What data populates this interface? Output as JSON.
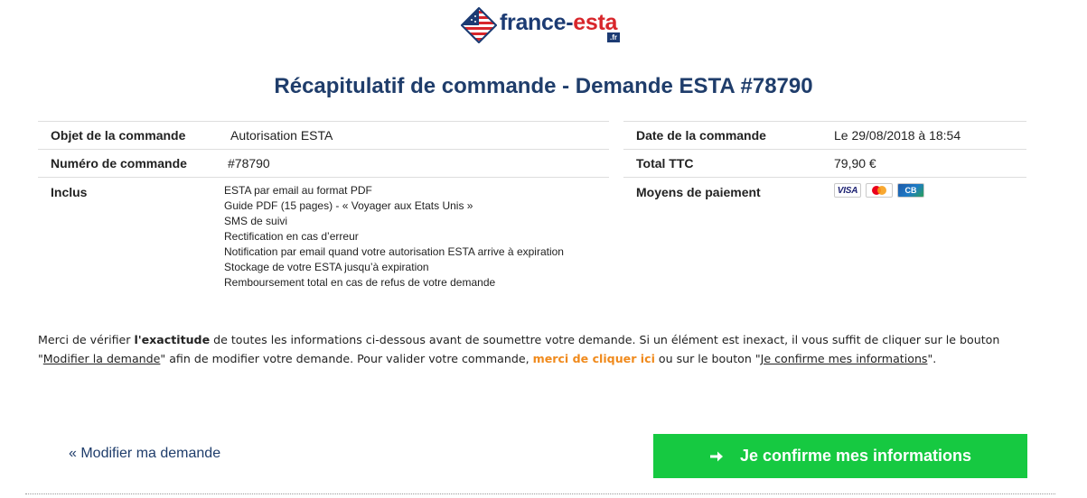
{
  "logo": {
    "part1": "france-",
    "part2": "esta",
    "tld": ".fr"
  },
  "title": "Récapitulatif de commande - Demande ESTA #78790",
  "order": {
    "object_label": "Objet de la commande",
    "object_value": "Autorisation ESTA",
    "number_label": "Numéro de commande",
    "number_value": "#78790",
    "includes_label": "Inclus",
    "includes": [
      "ESTA par email au format PDF",
      "Guide PDF (15 pages) - « Voyager aux Etats Unis »",
      "SMS de suivi",
      "Rectification en cas d’erreur",
      "Notification par email quand votre autorisation ESTA arrive à expiration",
      "Stockage de votre ESTA jusqu’à expiration",
      "Remboursement total en cas de refus de votre demande"
    ]
  },
  "summary": {
    "date_label": "Date de la commande",
    "date_value": "Le 29/08/2018 à 18:54",
    "total_label": "Total TTC",
    "total_value": "79,90 €",
    "payment_label": "Moyens de paiement",
    "payment_methods": [
      {
        "name": "visa-icon",
        "text": "VISA"
      },
      {
        "name": "mastercard-icon",
        "text": ""
      },
      {
        "name": "carte-bleue-icon",
        "text": "CB"
      }
    ]
  },
  "notice": {
    "t1": "Merci de vérifier ",
    "b1": "l'exactitude",
    "t2": " de toutes les informations ci-dessous avant de soumettre votre demande. Si un élément est inexact, il vous suffit de cliquer sur le bouton \"",
    "link1": "Modifier la demande",
    "t3": "\" afin de modifier votre demande. Pour valider votre commande, ",
    "link2": "merci de cliquer ici",
    "t4": " ou sur le bouton \"",
    "link3": "Je confirme mes informations",
    "t5": "\"."
  },
  "actions": {
    "back_label": "« Modifier ma demande",
    "confirm_label": "Je confirme mes informations"
  },
  "colors": {
    "title": "#1f3d6b",
    "confirm_bg": "#16c941",
    "orange_link": "#f08a1c"
  }
}
